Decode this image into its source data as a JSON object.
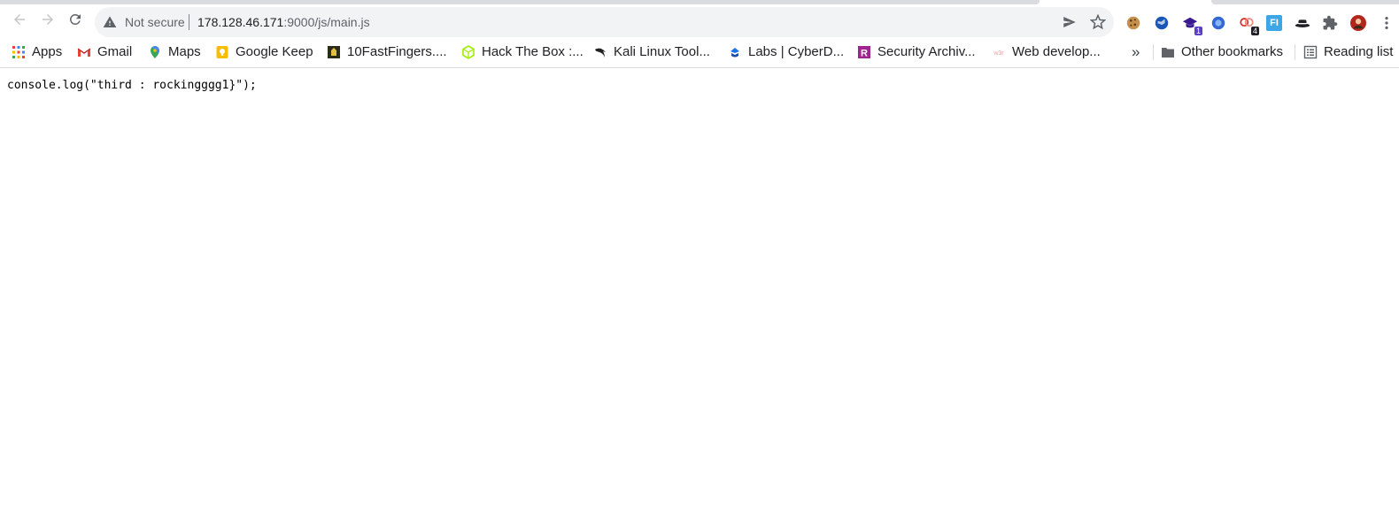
{
  "omnibox": {
    "security_label": "Not secure",
    "url_host": "178.128.46.171",
    "url_rest": ":9000/js/main.js"
  },
  "extensions": {
    "badge_1": "1",
    "badge_2": "4",
    "fi_label": "FI"
  },
  "bookmarks": {
    "items": [
      {
        "label": "Apps"
      },
      {
        "label": "Gmail"
      },
      {
        "label": "Maps"
      },
      {
        "label": "Google Keep"
      },
      {
        "label": "10FastFingers...."
      },
      {
        "label": "Hack The Box :..."
      },
      {
        "label": "Kali Linux Tool..."
      },
      {
        "label": "Labs | CyberD..."
      },
      {
        "label": "Security Archiv..."
      },
      {
        "label": "Web develop..."
      }
    ],
    "more_label": "»",
    "other_bookmarks": "Other bookmarks",
    "reading_list": "Reading list"
  },
  "page": {
    "source_text": "console.log(\"third : rockingggg1}\");"
  },
  "colors": {
    "accent": "#1a73e8",
    "omnibox_bg": "#f1f3f4",
    "border": "#dadce0"
  }
}
